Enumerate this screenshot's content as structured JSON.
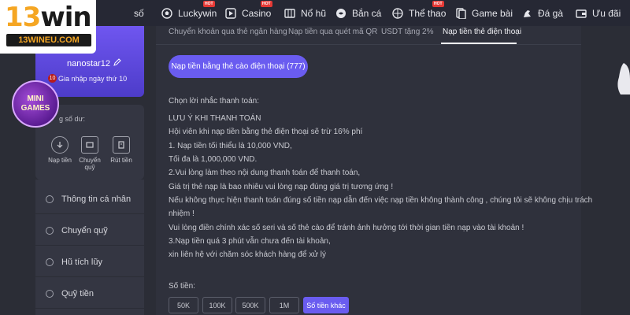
{
  "logo": {
    "brand_num": "13",
    "brand_word": "win",
    "sub": "13WINEU.COM"
  },
  "nav": {
    "items": [
      {
        "label": "số",
        "icon": "",
        "hot": false
      },
      {
        "label": "Luckywin",
        "icon": "soccer-ball-icon",
        "hot": true
      },
      {
        "label": "Casino",
        "icon": "play-icon",
        "hot": true
      },
      {
        "label": "Nổ hũ",
        "icon": "slot-icon",
        "hot": false
      },
      {
        "label": "Bắn cá",
        "icon": "fish-icon",
        "hot": false
      },
      {
        "label": "Thể thao",
        "icon": "sport-icon",
        "hot": true
      },
      {
        "label": "Game bài",
        "icon": "cards-icon",
        "hot": false
      },
      {
        "label": "Đá gà",
        "icon": "rooster-icon",
        "hot": false
      },
      {
        "label": "Ưu đãi",
        "icon": "wallet-icon",
        "hot": false
      }
    ],
    "hot_label": "HOT"
  },
  "profile": {
    "username": "nanostar12",
    "level": "10",
    "joined": "Gia nhập ngày thứ 10"
  },
  "minigames": {
    "line1": "MINI",
    "line2": "GAMES"
  },
  "balance": {
    "label": "g số dư:",
    "actions": [
      {
        "label": "Nạp tiền",
        "icon": "deposit-icon"
      },
      {
        "label": "Chuyển quỹ",
        "icon": "transfer-icon"
      },
      {
        "label": "Rút tiền",
        "icon": "withdraw-icon"
      }
    ]
  },
  "menu": {
    "items": [
      {
        "label": "Thông tin cá nhân",
        "icon": "user-icon"
      },
      {
        "label": "Chuyển quỹ",
        "icon": "transfer-icon"
      },
      {
        "label": "Hũ tích lũy",
        "icon": "jar-icon"
      },
      {
        "label": "Quỹ tiền",
        "icon": "fund-icon"
      }
    ]
  },
  "tabs": [
    {
      "label": "Chuyển khoản qua thẻ ngân hàng",
      "active": false
    },
    {
      "label": "Nạp tiền qua quét mã QR",
      "active": false
    },
    {
      "label": "USDT tặng 2%",
      "active": false
    },
    {
      "label": "Nạp tiền thẻ điện thoại",
      "active": true
    }
  ],
  "method_pill": "Nạp tiền bằng thẻ cào điện thoại  (777)",
  "content": {
    "choose_label": "Chọn lời nhắc thanh toán:",
    "lines": [
      "LƯU Ý KHI THANH TOÁN",
      "Hội viên khi nạp tiền bằng thẻ điện thoại sẽ trừ 16% phí",
      "1. Nạp tiền tối thiểu là 10,000 VND,",
      "Tối đa là 1,000,000 VND.",
      "2.Vui lòng làm theo nội dung thanh toán để thanh toán,",
      "Giá trị thẻ nạp là bao nhiêu vui lòng nạp đúng giá trị tương ứng !",
      "Nếu không thực hiện thanh toán đúng số tiền nạp dẫn đến việc nạp tiền không thành công , chúng tôi sẽ không chịu trách",
      "nhiệm !",
      "Vui lòng điền chính xác số seri và số thẻ cào để tránh ảnh hưởng tới thời gian tiền nạp vào tài khoản !",
      "3.Nạp tiền quá 3 phút vẫn chưa đến tài khoản,",
      "xin liên hệ với chăm sóc khách hàng để xử lý"
    ],
    "amount_label": "Số tiền:"
  },
  "amounts": [
    {
      "label": "50K",
      "active": false
    },
    {
      "label": "100K",
      "active": false
    },
    {
      "label": "500K",
      "active": false
    },
    {
      "label": "1M",
      "active": false
    },
    {
      "label": "Số tiền khác",
      "active": true
    }
  ],
  "colors": {
    "accent": "#6a5cf0",
    "background": "#2b2d36",
    "panel": "#2f313c"
  }
}
